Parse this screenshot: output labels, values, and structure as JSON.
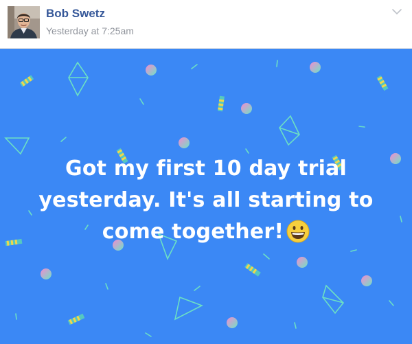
{
  "author": {
    "name": "Bob Swetz",
    "timestamp": "Yesterday at 7:25am",
    "avatar_icon": "avatar-photo"
  },
  "menu_icon": "chevron-down-icon",
  "status": {
    "text": "Got my first 10 day trial yesterday. It's all starting to come together!",
    "emoji": "grinning-face",
    "background_color": "#3b88f5",
    "text_color": "#ffffff"
  }
}
